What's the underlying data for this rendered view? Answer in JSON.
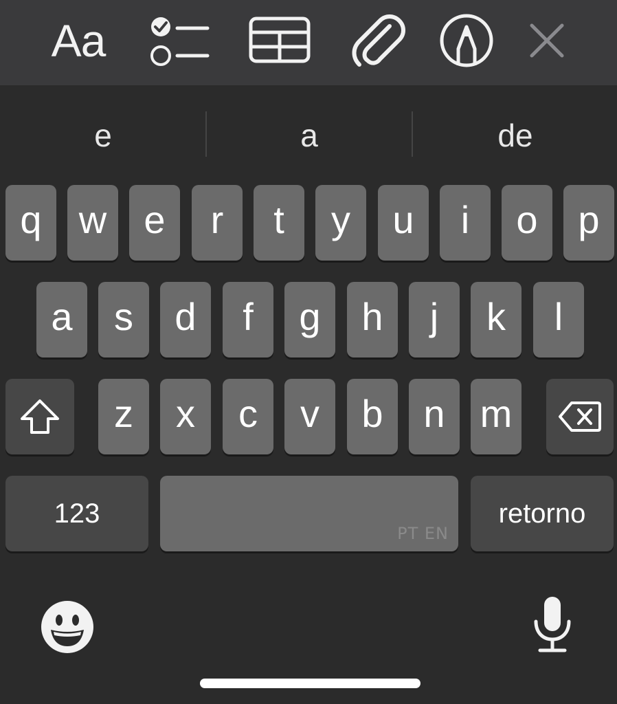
{
  "toolbar": {
    "format_label": "Aa",
    "icons": [
      "checklist-icon",
      "table-icon",
      "paperclip-icon",
      "markup-pen-icon",
      "close-icon"
    ]
  },
  "suggestions": [
    "e",
    "a",
    "de"
  ],
  "keyboard": {
    "row1": [
      "q",
      "w",
      "e",
      "r",
      "t",
      "y",
      "u",
      "i",
      "o",
      "p"
    ],
    "row2": [
      "a",
      "s",
      "d",
      "f",
      "g",
      "h",
      "j",
      "k",
      "l"
    ],
    "row3": [
      "z",
      "x",
      "c",
      "v",
      "b",
      "n",
      "m"
    ],
    "shift_icon": "shift-icon",
    "delete_icon": "backspace-icon",
    "numbers_label": "123",
    "space_lang": "PT EN",
    "return_label": "retorno"
  },
  "bottom": {
    "emoji_icon": "emoji-icon",
    "mic_icon": "microphone-icon"
  },
  "colors": {
    "toolbar_bg": "#3a3a3c",
    "keyboard_bg": "#2b2b2b",
    "letter_key": "#6b6b6b",
    "function_key": "#474747"
  }
}
